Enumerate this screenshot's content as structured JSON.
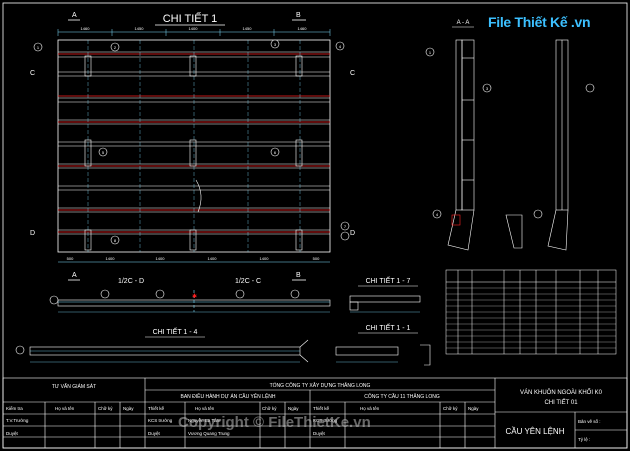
{
  "drawing": {
    "detail1_title": "CHI TIẾT 1",
    "section_aa_title": "A - A",
    "detail_1_7_title": "CHI TIẾT 1 - 7",
    "detail_1_1_title": "CHI TIẾT 1 - 1",
    "detail_1_4_title": "CHI TIẾT 1 - 4",
    "section_dd_title": "1/2C - D",
    "section_cc_title": "1/2C - C",
    "marker_a": "A",
    "marker_b": "B",
    "marker_c": "C",
    "marker_d": "D",
    "callouts": [
      "1",
      "2",
      "3",
      "4",
      "5",
      "6",
      "7",
      "8"
    ],
    "dim_top": [
      "1460",
      "1450",
      "1400",
      "1450",
      "1460"
    ],
    "dim_bottom": [
      "500",
      "1400",
      "1400",
      "1400",
      "1400",
      "500"
    ],
    "colors": {
      "background": "#000000",
      "line": "#ffffff",
      "red": "#ff2020",
      "cyan": "#7fe0ff",
      "yellow": "#ffe066"
    }
  },
  "title_block": {
    "consultant": "TƯ VẤN GIÁM SÁT",
    "company": "TỔNG CÔNG TY XÂY DỰNG THĂNG LONG",
    "board": "BAN ĐIỀU HÀNH DỰ ÁN CẦU YÊN LỆNH",
    "contractor": "CÔNG TY CẦU 11 THĂNG LONG",
    "drawing_title_1": "VÁN KHUÔN NGOÀI KHỐI K0",
    "drawing_title_2": "CHI TIẾT 01",
    "project": "CẦU YÊN LỆNH",
    "col_name": "Họ và tên",
    "col_sign": "Chữ ký",
    "col_date": "Ngày",
    "row_check": "Kiểm tra",
    "row_tv": "T.V.Trưởng",
    "row_approve": "Duyệt",
    "row_design": "Thiết kế",
    "row_kcs": "KCS trưởng",
    "row_approved2": "Duyệt",
    "person_1": "Nguyễn Ba Tâm",
    "person_2": "Vương Quang Trung",
    "drawing_no_label": "Bản vẽ số :",
    "scale_label": "Tỷ lệ :"
  },
  "watermarks": {
    "logo_text": "File Thiết Kế .vn",
    "copyright": "Copyright © FileThietKe.vn"
  }
}
